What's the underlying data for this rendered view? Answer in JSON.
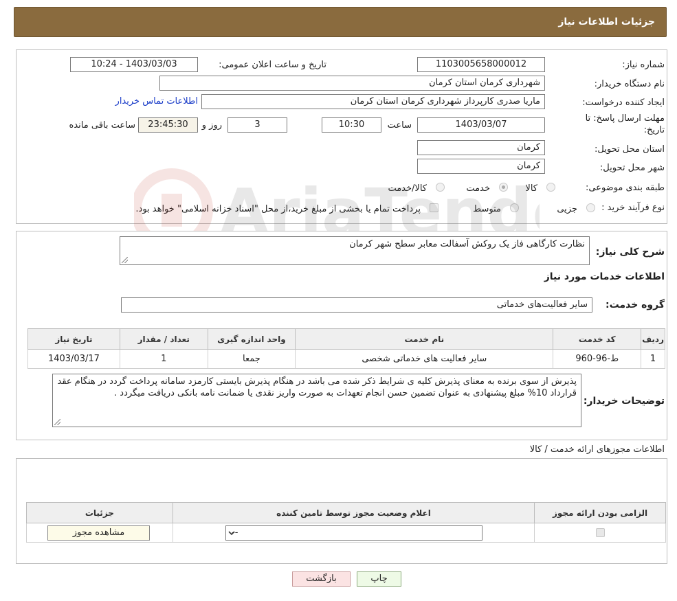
{
  "header": {
    "title": "جزئیات اطلاعات نیاز"
  },
  "form": {
    "need_number_label": "شماره نیاز:",
    "need_number": "1103005658000012",
    "announce_label": "تاریخ و ساعت اعلان عمومی:",
    "announce_value": "1403/03/03 - 10:24",
    "buyer_org_label": "نام دستگاه خریدار:",
    "buyer_org": "شهرداری کرمان استان کرمان",
    "creator_label": "ایجاد کننده درخواست:",
    "creator": "ماریا صدری کارپرداز شهرداری کرمان استان کرمان",
    "contact_link": "اطلاعات تماس خریدار",
    "deadline_label_1": "مهلت ارسال پاسخ: تا",
    "deadline_label_2": "تاریخ:",
    "deadline_date": "1403/03/07",
    "time_label": "ساعت",
    "deadline_time": "10:30",
    "days_value": "3",
    "days_label": "روز و",
    "remaining_time": "23:45:30",
    "remaining_label": "ساعت باقی مانده",
    "province_label": "استان محل تحویل:",
    "province": "کرمان",
    "city_label": "شهر محل تحویل:",
    "city": "کرمان",
    "category_label": "طبقه بندی موضوعی:",
    "category_options": [
      "کالا",
      "خدمت",
      "کالا/خدمت"
    ],
    "process_label": "نوع فرآیند خرید :",
    "process_options": [
      "جزیی",
      "متوسط"
    ],
    "payment_note": "پرداخت تمام یا بخشی از مبلغ خرید،از محل \"اسناد خزانه اسلامی\" خواهد بود."
  },
  "desc": {
    "label": "شرح کلی نیاز:",
    "value": "نظارت کارگاهی فاز یک روکش آسفالت معابر سطح شهر کرمان",
    "services_title": "اطلاعات خدمات مورد نیاز",
    "group_label": "گروه خدمت:",
    "group_value": "سایر فعالیت‌های خدماتی"
  },
  "services_table": {
    "headers": [
      "ردیف",
      "کد خدمت",
      "نام خدمت",
      "واحد اندازه گیری",
      "تعداد / مقدار",
      "تاریخ نیاز"
    ],
    "rows": [
      [
        "1",
        "ط-96-960",
        "سایر فعالیت های خدماتی شخصی",
        "جمعا",
        "1",
        "1403/03/17"
      ]
    ]
  },
  "buyer_notes": {
    "label": "توضیحات خریدار:",
    "value": "پذیرش از سوی برنده به معنای پذیرش کلیه ی شرایط ذکر شده می باشد در هنگام پذیرش بایستی کارمزد سامانه پرداخت گردد در هنگام عقد قرارداد 10% مبلغ پیشنهادی به عنوان تضمین حسن انجام تعهدات به صورت واریز نقدی یا ضمانت نامه بانکی دریافت میگردد ."
  },
  "permits": {
    "title": "اطلاعات مجوزهای ارائه خدمت / کالا",
    "headers": [
      "الزامی بودن ارائه مجوز",
      "اعلام وضعیت مجوز توسط تامین کننده",
      "جزئیات"
    ],
    "select_value": "--",
    "view_button": "مشاهده مجوز"
  },
  "footer": {
    "print_button": "چاپ",
    "back_button": "بازگشت"
  },
  "watermark_text": "AriaTender.neT"
}
